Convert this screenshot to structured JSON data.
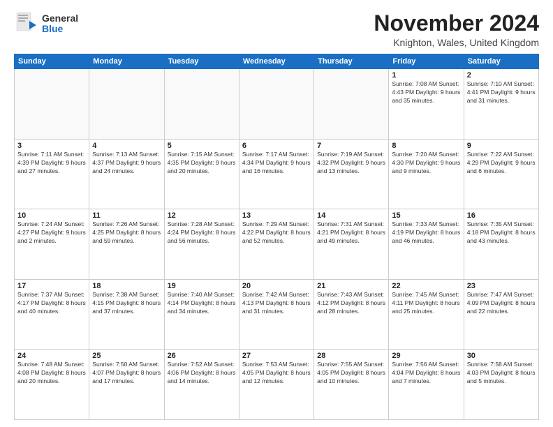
{
  "logo": {
    "general": "General",
    "blue": "Blue"
  },
  "header": {
    "month": "November 2024",
    "location": "Knighton, Wales, United Kingdom"
  },
  "weekdays": [
    "Sunday",
    "Monday",
    "Tuesday",
    "Wednesday",
    "Thursday",
    "Friday",
    "Saturday"
  ],
  "weeks": [
    [
      {
        "day": "",
        "info": ""
      },
      {
        "day": "",
        "info": ""
      },
      {
        "day": "",
        "info": ""
      },
      {
        "day": "",
        "info": ""
      },
      {
        "day": "",
        "info": ""
      },
      {
        "day": "1",
        "info": "Sunrise: 7:08 AM\nSunset: 4:43 PM\nDaylight: 9 hours\nand 35 minutes."
      },
      {
        "day": "2",
        "info": "Sunrise: 7:10 AM\nSunset: 4:41 PM\nDaylight: 9 hours\nand 31 minutes."
      }
    ],
    [
      {
        "day": "3",
        "info": "Sunrise: 7:11 AM\nSunset: 4:39 PM\nDaylight: 9 hours\nand 27 minutes."
      },
      {
        "day": "4",
        "info": "Sunrise: 7:13 AM\nSunset: 4:37 PM\nDaylight: 9 hours\nand 24 minutes."
      },
      {
        "day": "5",
        "info": "Sunrise: 7:15 AM\nSunset: 4:35 PM\nDaylight: 9 hours\nand 20 minutes."
      },
      {
        "day": "6",
        "info": "Sunrise: 7:17 AM\nSunset: 4:34 PM\nDaylight: 9 hours\nand 16 minutes."
      },
      {
        "day": "7",
        "info": "Sunrise: 7:19 AM\nSunset: 4:32 PM\nDaylight: 9 hours\nand 13 minutes."
      },
      {
        "day": "8",
        "info": "Sunrise: 7:20 AM\nSunset: 4:30 PM\nDaylight: 9 hours\nand 9 minutes."
      },
      {
        "day": "9",
        "info": "Sunrise: 7:22 AM\nSunset: 4:29 PM\nDaylight: 9 hours\nand 6 minutes."
      }
    ],
    [
      {
        "day": "10",
        "info": "Sunrise: 7:24 AM\nSunset: 4:27 PM\nDaylight: 9 hours\nand 2 minutes."
      },
      {
        "day": "11",
        "info": "Sunrise: 7:26 AM\nSunset: 4:25 PM\nDaylight: 8 hours\nand 59 minutes."
      },
      {
        "day": "12",
        "info": "Sunrise: 7:28 AM\nSunset: 4:24 PM\nDaylight: 8 hours\nand 56 minutes."
      },
      {
        "day": "13",
        "info": "Sunrise: 7:29 AM\nSunset: 4:22 PM\nDaylight: 8 hours\nand 52 minutes."
      },
      {
        "day": "14",
        "info": "Sunrise: 7:31 AM\nSunset: 4:21 PM\nDaylight: 8 hours\nand 49 minutes."
      },
      {
        "day": "15",
        "info": "Sunrise: 7:33 AM\nSunset: 4:19 PM\nDaylight: 8 hours\nand 46 minutes."
      },
      {
        "day": "16",
        "info": "Sunrise: 7:35 AM\nSunset: 4:18 PM\nDaylight: 8 hours\nand 43 minutes."
      }
    ],
    [
      {
        "day": "17",
        "info": "Sunrise: 7:37 AM\nSunset: 4:17 PM\nDaylight: 8 hours\nand 40 minutes."
      },
      {
        "day": "18",
        "info": "Sunrise: 7:38 AM\nSunset: 4:15 PM\nDaylight: 8 hours\nand 37 minutes."
      },
      {
        "day": "19",
        "info": "Sunrise: 7:40 AM\nSunset: 4:14 PM\nDaylight: 8 hours\nand 34 minutes."
      },
      {
        "day": "20",
        "info": "Sunrise: 7:42 AM\nSunset: 4:13 PM\nDaylight: 8 hours\nand 31 minutes."
      },
      {
        "day": "21",
        "info": "Sunrise: 7:43 AM\nSunset: 4:12 PM\nDaylight: 8 hours\nand 28 minutes."
      },
      {
        "day": "22",
        "info": "Sunrise: 7:45 AM\nSunset: 4:11 PM\nDaylight: 8 hours\nand 25 minutes."
      },
      {
        "day": "23",
        "info": "Sunrise: 7:47 AM\nSunset: 4:09 PM\nDaylight: 8 hours\nand 22 minutes."
      }
    ],
    [
      {
        "day": "24",
        "info": "Sunrise: 7:48 AM\nSunset: 4:08 PM\nDaylight: 8 hours\nand 20 minutes."
      },
      {
        "day": "25",
        "info": "Sunrise: 7:50 AM\nSunset: 4:07 PM\nDaylight: 8 hours\nand 17 minutes."
      },
      {
        "day": "26",
        "info": "Sunrise: 7:52 AM\nSunset: 4:06 PM\nDaylight: 8 hours\nand 14 minutes."
      },
      {
        "day": "27",
        "info": "Sunrise: 7:53 AM\nSunset: 4:05 PM\nDaylight: 8 hours\nand 12 minutes."
      },
      {
        "day": "28",
        "info": "Sunrise: 7:55 AM\nSunset: 4:05 PM\nDaylight: 8 hours\nand 10 minutes."
      },
      {
        "day": "29",
        "info": "Sunrise: 7:56 AM\nSunset: 4:04 PM\nDaylight: 8 hours\nand 7 minutes."
      },
      {
        "day": "30",
        "info": "Sunrise: 7:58 AM\nSunset: 4:03 PM\nDaylight: 8 hours\nand 5 minutes."
      }
    ]
  ]
}
